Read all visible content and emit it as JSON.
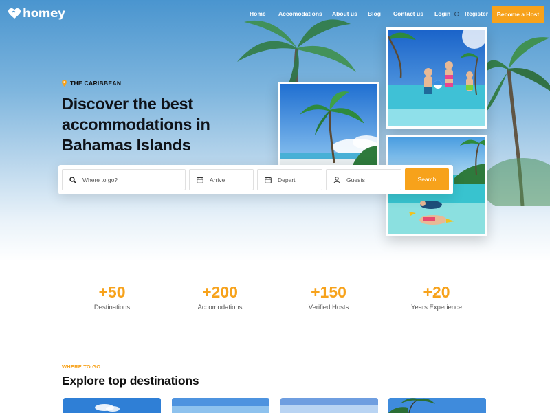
{
  "brand": {
    "name": "homey"
  },
  "nav": {
    "items": [
      {
        "label": "Home"
      },
      {
        "label": "Accomodations"
      },
      {
        "label": "About us"
      },
      {
        "label": "Blog"
      },
      {
        "label": "Contact us"
      },
      {
        "label": "Login"
      },
      {
        "label": "Register"
      }
    ],
    "cta_label": "Become a Host"
  },
  "hero": {
    "location": "THE CARIBBEAN",
    "title": "Discover the best accommodations in Bahamas Islands"
  },
  "search": {
    "where_placeholder": "Where to go?",
    "arrive_placeholder": "Arrive",
    "depart_placeholder": "Depart",
    "guests_placeholder": "Guests",
    "button_label": "Search"
  },
  "stats": [
    {
      "value": "+50",
      "label": "Destinations"
    },
    {
      "value": "+200",
      "label": "Accomodations"
    },
    {
      "value": "+150",
      "label": "Verified Hosts"
    },
    {
      "value": "+20",
      "label": "Years Experience"
    }
  ],
  "destinations": {
    "eyebrow": "WHERE TO GO",
    "title": "Explore top destinations"
  },
  "icons": {
    "logo": "heart-icon",
    "location": "map-pin-icon",
    "where": "search-icon",
    "arrive": "calendar-icon",
    "depart": "calendar-icon",
    "guests": "user-icon"
  },
  "colors": {
    "accent": "#f7a21b",
    "heading": "#0f1218",
    "sky": "#4a95cf"
  }
}
